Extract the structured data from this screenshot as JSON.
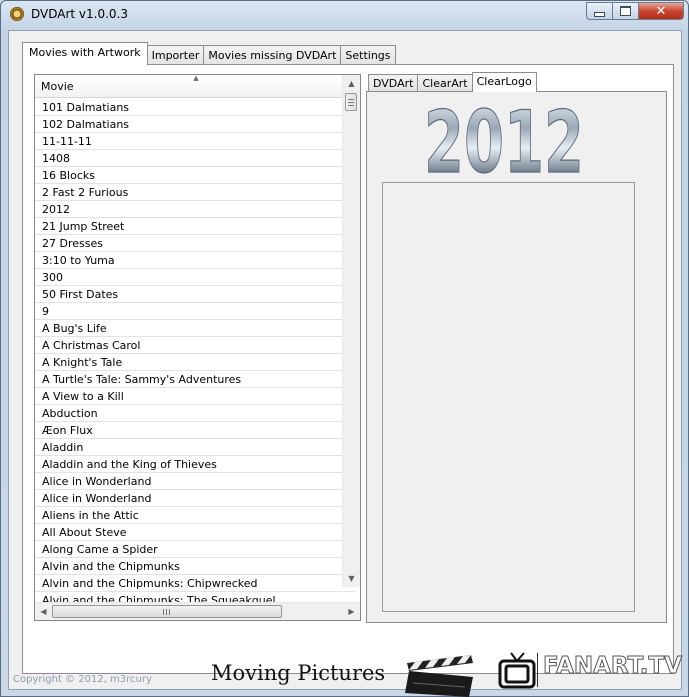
{
  "window": {
    "title": "DVDArt v1.0.0.3",
    "close_glyph": "✕"
  },
  "main_tabs": [
    {
      "label": "Movies with Artwork",
      "active": true
    },
    {
      "label": "Importer",
      "active": false
    },
    {
      "label": "Movies missing DVDArt",
      "active": false
    },
    {
      "label": "Settings",
      "active": false
    }
  ],
  "list": {
    "column_header": "Movie",
    "items": [
      "101 Dalmatians",
      "102 Dalmatians",
      "11-11-11",
      "1408",
      "16 Blocks",
      "2 Fast 2 Furious",
      "2012",
      "21 Jump Street",
      "27 Dresses",
      "3:10 to Yuma",
      "300",
      "50 First Dates",
      "9",
      "A Bug's Life",
      "A Christmas Carol",
      "A Knight's Tale",
      "A Turtle's Tale: Sammy's Adventures",
      "A View to a Kill",
      "Abduction",
      "Æon Flux",
      "Aladdin",
      "Aladdin and the King of Thieves",
      "Alice in Wonderland",
      "Alice in Wonderland",
      "Aliens in the Attic",
      "All About Steve",
      "Along Came a Spider",
      "Alvin and the Chipmunks",
      "Alvin and the Chipmunks: Chipwrecked",
      "Alvin and the Chipmunks: The Squeakquel"
    ]
  },
  "art_tabs": [
    {
      "label": "DVDArt",
      "active": false
    },
    {
      "label": "ClearArt",
      "active": false
    },
    {
      "label": "ClearLogo",
      "active": true
    }
  ],
  "clearlogo": {
    "text": "2012"
  },
  "footer": {
    "moving_pictures": "Moving Pictures",
    "fanart": "FANART.TV",
    "copyright": "Copyright © 2012, m3rcury"
  }
}
